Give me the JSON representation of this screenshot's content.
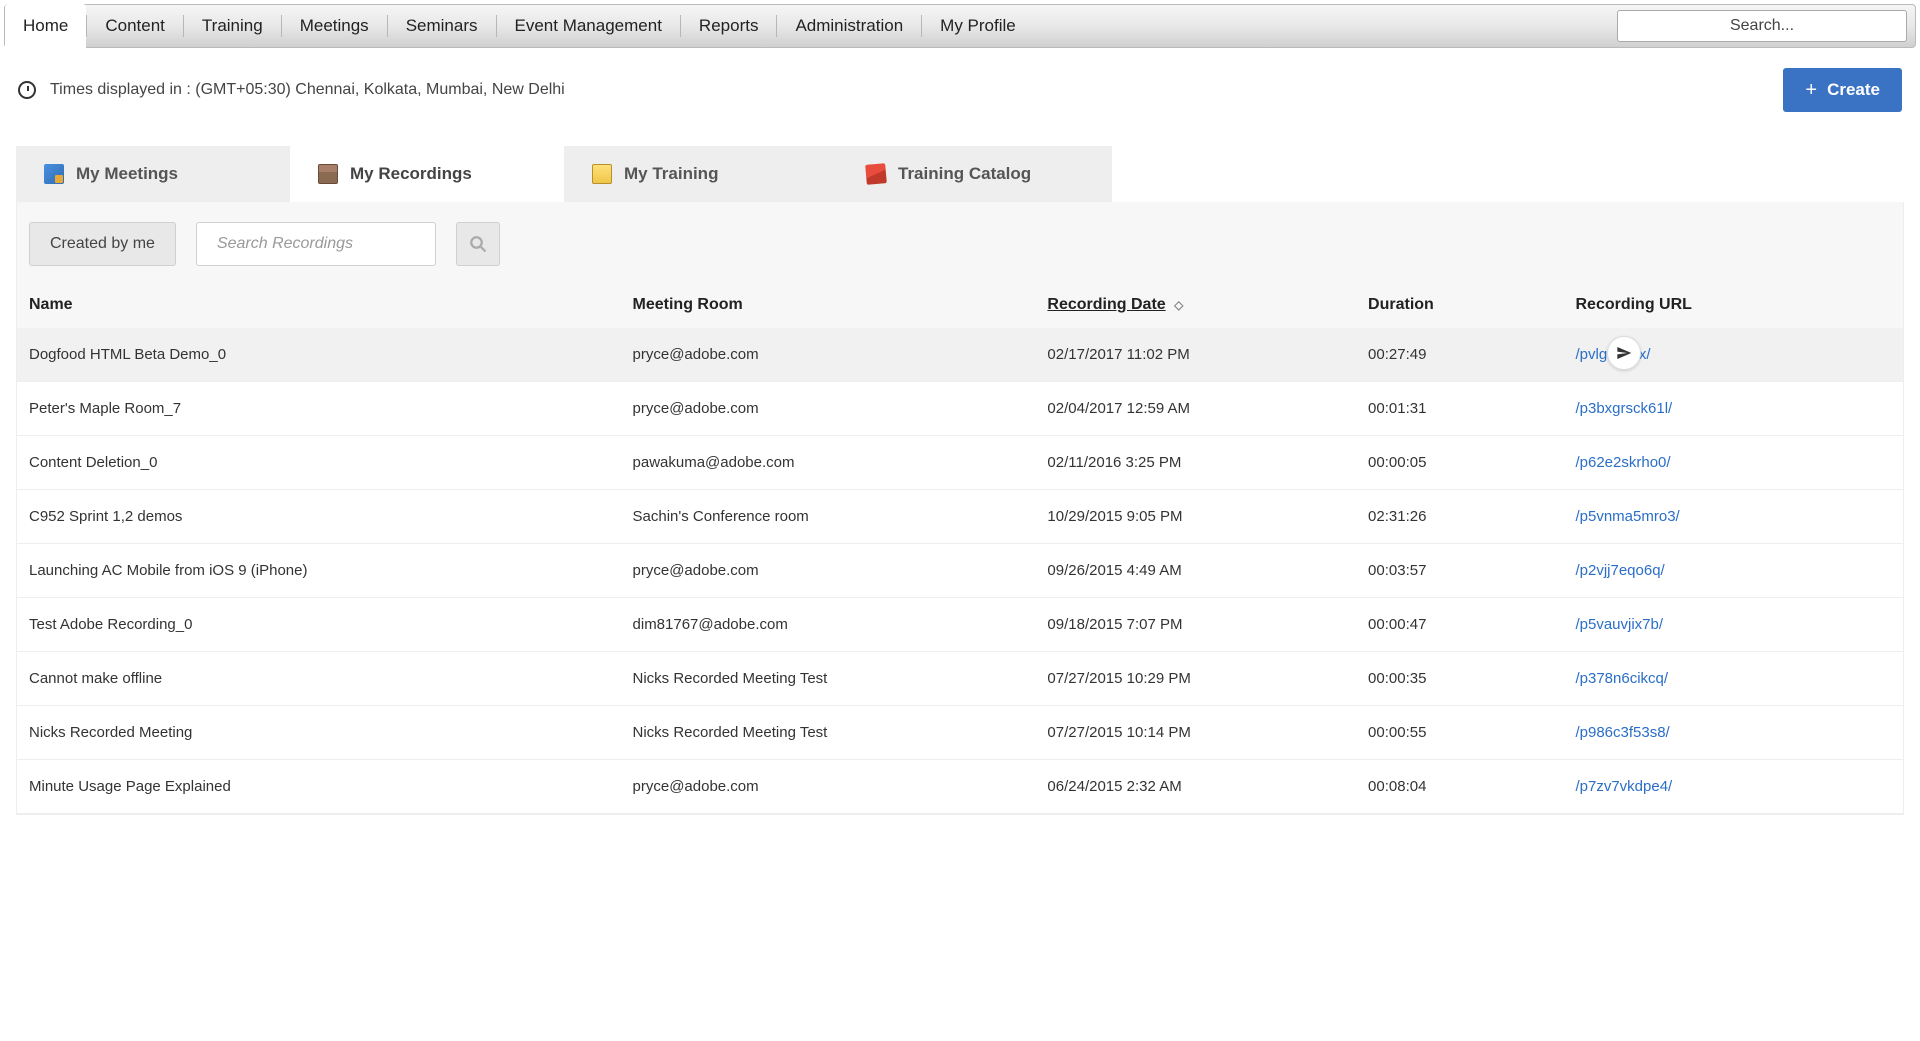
{
  "nav": {
    "items": [
      {
        "label": "Home",
        "active": true
      },
      {
        "label": "Content"
      },
      {
        "label": "Training"
      },
      {
        "label": "Meetings"
      },
      {
        "label": "Seminars"
      },
      {
        "label": "Event Management"
      },
      {
        "label": "Reports"
      },
      {
        "label": "Administration"
      },
      {
        "label": "My Profile"
      }
    ],
    "search_placeholder": "Search..."
  },
  "info": {
    "timezone_text": "Times displayed in : (GMT+05:30) Chennai, Kolkata, Mumbai, New Delhi",
    "create_label": "Create"
  },
  "tabs": [
    {
      "label": "My Meetings"
    },
    {
      "label": "My Recordings",
      "active": true
    },
    {
      "label": "My Training"
    },
    {
      "label": "Training Catalog"
    }
  ],
  "filter": {
    "created_by_me": "Created by me",
    "search_placeholder": "Search Recordings"
  },
  "table": {
    "headers": {
      "name": "Name",
      "room": "Meeting Room",
      "date": "Recording Date",
      "duration": "Duration",
      "url": "Recording URL"
    },
    "rows": [
      {
        "name": "Dogfood HTML Beta Demo_0",
        "room": "pryce@adobe.com",
        "date": "02/17/2017 11:02 PM",
        "duration": "00:27:49",
        "url": "/pvlgchoitx/",
        "highlighted": true,
        "share_icon": true
      },
      {
        "name": "Peter's Maple Room_7",
        "room": "pryce@adobe.com",
        "date": "02/04/2017 12:59 AM",
        "duration": "00:01:31",
        "url": "/p3bxgrsck61l/"
      },
      {
        "name": "Content Deletion_0",
        "room": "pawakuma@adobe.com",
        "date": "02/11/2016 3:25 PM",
        "duration": "00:00:05",
        "url": "/p62e2skrho0/"
      },
      {
        "name": "C952 Sprint 1,2 demos",
        "room": "Sachin's Conference room",
        "date": "10/29/2015 9:05 PM",
        "duration": "02:31:26",
        "url": "/p5vnma5mro3/"
      },
      {
        "name": "Launching AC Mobile from iOS 9 (iPhone)",
        "room": "pryce@adobe.com",
        "date": "09/26/2015 4:49 AM",
        "duration": "00:03:57",
        "url": "/p2vjj7eqo6q/"
      },
      {
        "name": "Test Adobe Recording_0",
        "room": "dim81767@adobe.com",
        "date": "09/18/2015 7:07 PM",
        "duration": "00:00:47",
        "url": "/p5vauvjix7b/"
      },
      {
        "name": "Cannot make offline",
        "room": "Nicks Recorded Meeting Test",
        "date": "07/27/2015 10:29 PM",
        "duration": "00:00:35",
        "url": "/p378n6cikcq/"
      },
      {
        "name": "Nicks Recorded Meeting",
        "room": "Nicks Recorded Meeting Test",
        "date": "07/27/2015 10:14 PM",
        "duration": "00:00:55",
        "url": "/p986c3f53s8/"
      },
      {
        "name": "Minute Usage Page Explained",
        "room": "pryce@adobe.com",
        "date": "06/24/2015 2:32 AM",
        "duration": "00:08:04",
        "url": "/p7zv7vkdpe4/"
      }
    ]
  }
}
